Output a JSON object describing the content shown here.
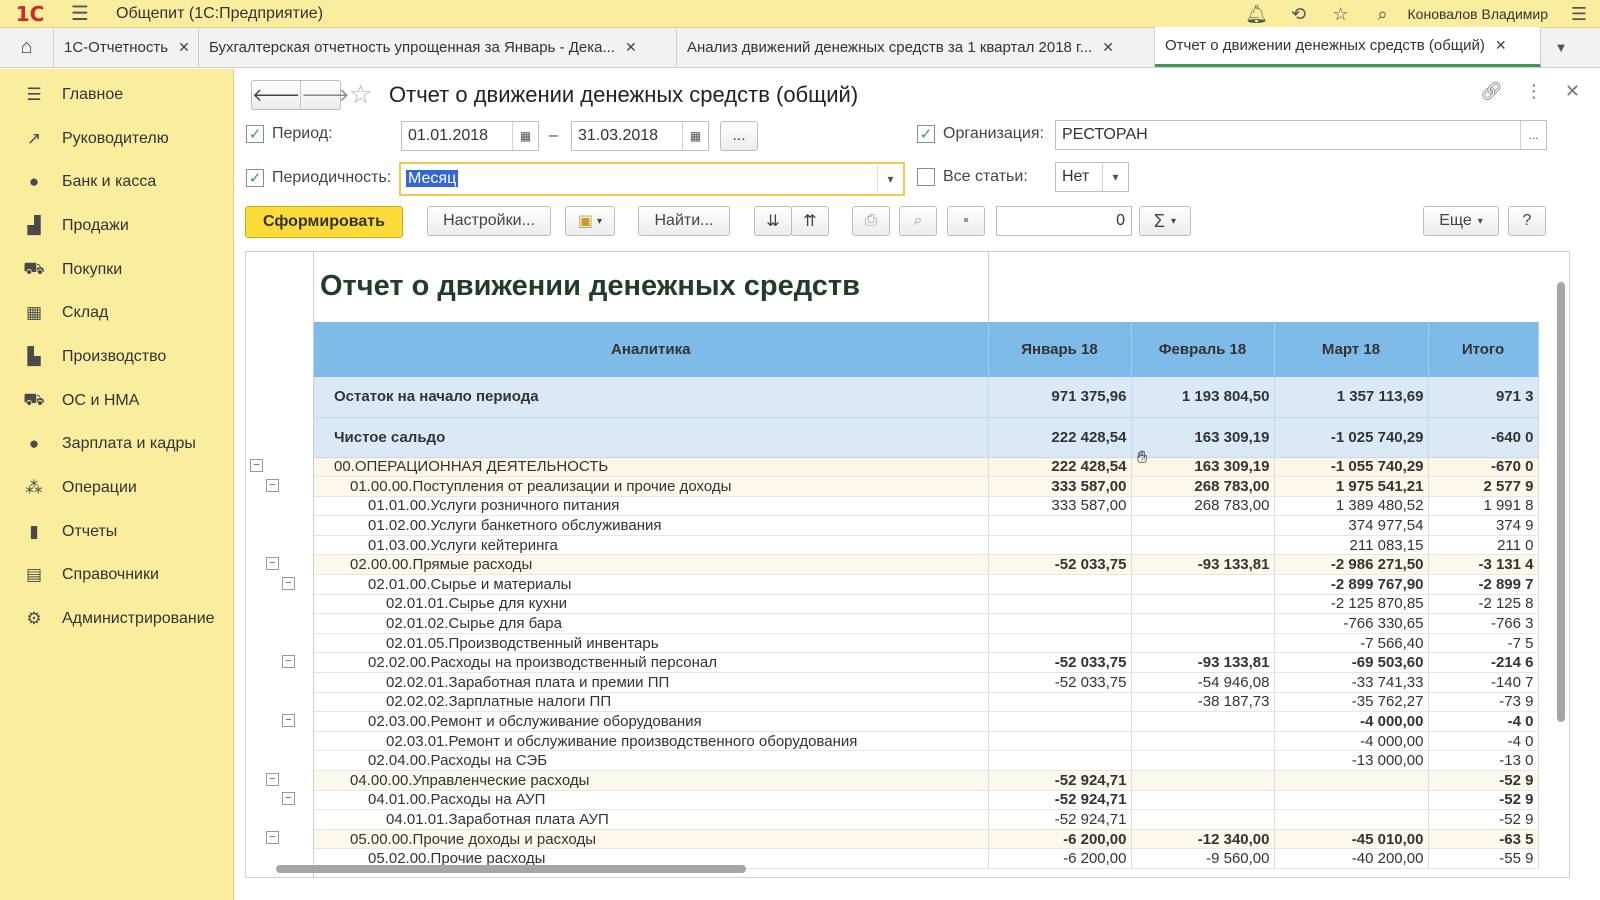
{
  "app": {
    "logo": "1С",
    "title": "Общепит  (1С:Предприятие)",
    "user": "Коновалов Владимир"
  },
  "tabs": [
    {
      "label": "1С-Отчетность"
    },
    {
      "label": "Бухгалтерская отчетность упрощенная за Январь - Дека..."
    },
    {
      "label": "Анализ движений денежных средств за 1 квартал 2018 г..."
    },
    {
      "label": "Отчет о движении денежных средств (общий)"
    }
  ],
  "sidebar": {
    "items": [
      {
        "label": "Главное",
        "icon": "menu-lines-icon"
      },
      {
        "label": "Руководителю",
        "icon": "trend-icon"
      },
      {
        "label": "Банк и касса",
        "icon": "coins-icon"
      },
      {
        "label": "Продажи",
        "icon": "bag-icon"
      },
      {
        "label": "Покупки",
        "icon": "cart-icon"
      },
      {
        "label": "Склад",
        "icon": "warehouse-icon"
      },
      {
        "label": "Производство",
        "icon": "factory-icon"
      },
      {
        "label": "ОС и НМА",
        "icon": "truck-icon"
      },
      {
        "label": "Зарплата и кадры",
        "icon": "person-icon"
      },
      {
        "label": "Операции",
        "icon": "operations-icon"
      },
      {
        "label": "Отчеты",
        "icon": "bar-chart-icon"
      },
      {
        "label": "Справочники",
        "icon": "books-icon"
      },
      {
        "label": "Администрирование",
        "icon": "gear-icon"
      }
    ]
  },
  "form": {
    "title": "Отчет о движении денежных средств (общий)",
    "period_label": "Период:",
    "period_from": "01.01.2018",
    "period_dash": "–",
    "period_to": "31.03.2018",
    "period_more": "...",
    "org_label": "Организация:",
    "org_value": "РЕСТОРАН",
    "org_more": "...",
    "periodicity_label": "Периодичность:",
    "periodicity_value": "Месяц",
    "all_items_label": "Все статьи:",
    "all_items_value": "Нет"
  },
  "toolbar": {
    "generate": "Сформировать",
    "settings": "Настройки...",
    "find": "Найти...",
    "counter": "0",
    "sigma": "Σ",
    "more": "Еще",
    "help": "?"
  },
  "report": {
    "title": "Отчет о движении денежных средств",
    "columns": [
      "Аналитика",
      "Январь 18",
      "Февраль 18",
      "Март 18",
      "Итого"
    ],
    "summary_rows": [
      {
        "name": "Остаток на начало периода",
        "v": [
          "971 375,96",
          "1 193 804,50",
          "1 357 113,69",
          "971 3"
        ]
      },
      {
        "name": "Чистое сальдо",
        "v": [
          "222 428,54",
          "163 309,19",
          "-1 025 740,29",
          "-640 0"
        ]
      }
    ],
    "rows": [
      {
        "name": "00.ОПЕРАЦИОННАЯ ДЕЯТЕЛЬНОСТЬ",
        "level": 0,
        "bold": true,
        "v": [
          "222 428,54",
          "163 309,19",
          "-1 055 740,29",
          "-670 0"
        ]
      },
      {
        "name": "01.00.00.Поступления от реализации и прочие доходы",
        "level": 1,
        "bold": true,
        "v": [
          "333 587,00",
          "268 783,00",
          "1 975 541,21",
          "2 577 9"
        ]
      },
      {
        "name": "01.01.00.Услуги розничного питания",
        "level": 2,
        "bold": false,
        "v": [
          "333 587,00",
          "268 783,00",
          "1 389 480,52",
          "1 991 8"
        ]
      },
      {
        "name": "01.02.00.Услуги банкетного обслуживания",
        "level": 2,
        "bold": false,
        "v": [
          "",
          "",
          "374 977,54",
          "374 9"
        ]
      },
      {
        "name": "01.03.00.Услуги кейтеринга",
        "level": 2,
        "bold": false,
        "v": [
          "",
          "",
          "211 083,15",
          "211 0"
        ]
      },
      {
        "name": "02.00.00.Прямые расходы",
        "level": 1,
        "bold": true,
        "v": [
          "-52 033,75",
          "-93 133,81",
          "-2 986 271,50",
          "-3 131 4"
        ]
      },
      {
        "name": "02.01.00.Сырье и материалы",
        "level": 2,
        "bold": true,
        "v": [
          "",
          "",
          "-2 899 767,90",
          "-2 899 7"
        ]
      },
      {
        "name": "02.01.01.Сырье для кухни",
        "level": 3,
        "bold": false,
        "v": [
          "",
          "",
          "-2 125 870,85",
          "-2 125 8"
        ]
      },
      {
        "name": "02.01.02.Сырье для бара",
        "level": 3,
        "bold": false,
        "v": [
          "",
          "",
          "-766 330,65",
          "-766 3"
        ]
      },
      {
        "name": "02.01.05.Производственный инвентарь",
        "level": 3,
        "bold": false,
        "v": [
          "",
          "",
          "-7 566,40",
          "-7 5"
        ]
      },
      {
        "name": "02.02.00.Расходы на производственный персонал",
        "level": 2,
        "bold": true,
        "v": [
          "-52 033,75",
          "-93 133,81",
          "-69 503,60",
          "-214 6"
        ]
      },
      {
        "name": "02.02.01.Заработная плата и премии ПП",
        "level": 3,
        "bold": false,
        "v": [
          "-52 033,75",
          "-54 946,08",
          "-33 741,33",
          "-140 7"
        ]
      },
      {
        "name": "02.02.02.Зарплатные налоги ПП",
        "level": 3,
        "bold": false,
        "v": [
          "",
          "-38 187,73",
          "-35 762,27",
          "-73 9"
        ]
      },
      {
        "name": "02.03.00.Ремонт и обслуживание оборудования",
        "level": 2,
        "bold": true,
        "v": [
          "",
          "",
          "-4 000,00",
          "-4 0"
        ]
      },
      {
        "name": "02.03.01.Ремонт и обслуживание производственного оборудования",
        "level": 3,
        "bold": false,
        "v": [
          "",
          "",
          "-4 000,00",
          "-4 0"
        ]
      },
      {
        "name": "02.04.00.Расходы на СЭБ",
        "level": 2,
        "bold": false,
        "v": [
          "",
          "",
          "-13 000,00",
          "-13 0"
        ]
      },
      {
        "name": "04.00.00.Управленческие расходы",
        "level": 1,
        "bold": true,
        "v": [
          "-52 924,71",
          "",
          "",
          "-52 9"
        ]
      },
      {
        "name": "04.01.00.Расходы на АУП",
        "level": 2,
        "bold": true,
        "v": [
          "-52 924,71",
          "",
          "",
          "-52 9"
        ]
      },
      {
        "name": "04.01.01.Заработная плата АУП",
        "level": 3,
        "bold": false,
        "v": [
          "-52 924,71",
          "",
          "",
          "-52 9"
        ]
      },
      {
        "name": "05.00.00.Прочие доходы и расходы",
        "level": 1,
        "bold": true,
        "v": [
          "-6 200,00",
          "-12 340,00",
          "-45 010,00",
          "-63 5"
        ]
      },
      {
        "name": "05.02.00.Прочие расходы",
        "level": 2,
        "bold": false,
        "v": [
          "-6 200,00",
          "-9 560,00",
          "-40 200,00",
          "-55 9"
        ]
      }
    ]
  },
  "colors": {
    "topbar": "#fbed9e",
    "header": "#7fbbe8",
    "summary": "#dbe9f7",
    "accent": "#fddc3a",
    "check": "#3c9a55"
  }
}
